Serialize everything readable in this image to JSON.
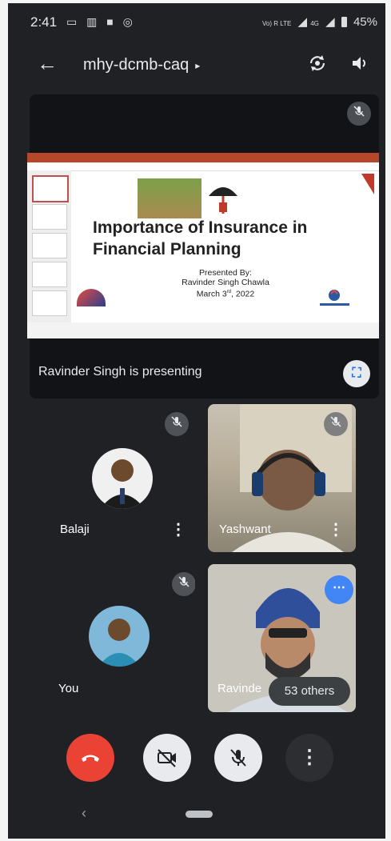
{
  "status_bar": {
    "time": "2:41",
    "network": "Vo) R LTE",
    "signal_4g": "4G",
    "battery": "45%"
  },
  "app_bar": {
    "meeting_code": "mhy-dcmb-caq",
    "caret": "▸"
  },
  "presentation": {
    "slide_title": "Importance of Insurance in Financial Planning",
    "presented_by": "Presented By:",
    "presenter": "Ravinder Singh Chawla",
    "date_main": "March 3",
    "date_sup": "rd",
    "date_year": ", 2022",
    "presenting_text": "Ravinder Singh is presenting"
  },
  "participants": [
    {
      "name": "Balaji"
    },
    {
      "name": "Yashwant"
    },
    {
      "name": "You"
    },
    {
      "name": "Ravinde"
    }
  ],
  "others_badge": "53 others",
  "colors": {
    "end_call": "#ea4335",
    "accent": "#1a73e8",
    "background": "#202124"
  }
}
